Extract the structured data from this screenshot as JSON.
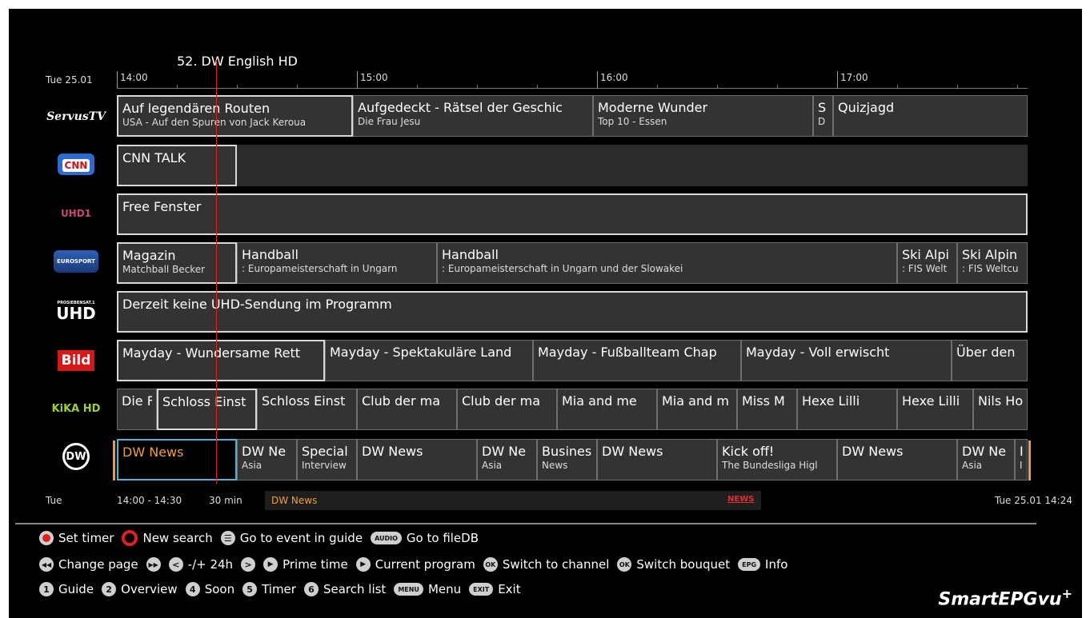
{
  "header": {
    "channel_title": "52. DW English HD",
    "date": "Tue 25.01",
    "hours": [
      "14:00",
      "15:00",
      "16:00",
      "17:00"
    ]
  },
  "channels": [
    {
      "logo": "ServusTV",
      "programs": [
        {
          "title": "Auf legendären Routen",
          "subtitle": "USA - Auf den Spuren von Jack Keroua",
          "selected": true
        },
        {
          "title": "Aufgedeckt - Rätsel der Geschic",
          "subtitle": "Die Frau Jesu"
        },
        {
          "title": "Moderne Wunder",
          "subtitle": "Top 10 - Essen"
        },
        {
          "title": "S",
          "subtitle": "D"
        },
        {
          "title": "Quizjagd",
          "subtitle": ""
        }
      ]
    },
    {
      "logo": "CNN",
      "programs": [
        {
          "title": "CNN TALK",
          "subtitle": "",
          "selected": true
        }
      ]
    },
    {
      "logo": "UHD1",
      "programs": [
        {
          "title": "Free Fenster",
          "subtitle": "",
          "selected": true
        }
      ]
    },
    {
      "logo": "EUROSPORT",
      "programs": [
        {
          "title": "Magazin",
          "subtitle": "Matchball Becker",
          "selected": true
        },
        {
          "title": "Handball",
          "subtitle": ": Europameisterschaft in Ungarn"
        },
        {
          "title": "Handball",
          "subtitle": ": Europameisterschaft in Ungarn und der Slowakei"
        },
        {
          "title": "Ski Alpi",
          "subtitle": ": FIS Welt"
        },
        {
          "title": "Ski Alpin",
          "subtitle": ": FIS Weltcu"
        }
      ]
    },
    {
      "logo": "UHD",
      "logo_small": "PROSIEBENSAT.1",
      "programs": [
        {
          "title": "Derzeit keine UHD-Sendung im Programm",
          "subtitle": "",
          "selected": true
        }
      ]
    },
    {
      "logo": "Bild",
      "programs": [
        {
          "title": "Mayday - Wundersame Rett",
          "subtitle": "",
          "selected": true
        },
        {
          "title": "Mayday - Spektakuläre Land",
          "subtitle": ""
        },
        {
          "title": "Mayday - Fußballteam Chap",
          "subtitle": ""
        },
        {
          "title": "Mayday - Voll erwischt",
          "subtitle": ""
        },
        {
          "title": "Über den",
          "subtitle": ""
        }
      ]
    },
    {
      "logo": "KiKA HD",
      "programs": [
        {
          "title": "Die F",
          "subtitle": ""
        },
        {
          "title": "Schloss Einst",
          "subtitle": "",
          "selected": true
        },
        {
          "title": "Schloss Einst",
          "subtitle": ""
        },
        {
          "title": "Club der ma",
          "subtitle": ""
        },
        {
          "title": "Club der ma",
          "subtitle": ""
        },
        {
          "title": "Mia and me",
          "subtitle": ""
        },
        {
          "title": "Mia and m",
          "subtitle": ""
        },
        {
          "title": "Miss M",
          "subtitle": ""
        },
        {
          "title": "Hexe Lilli",
          "subtitle": ""
        },
        {
          "title": "Hexe Lilli",
          "subtitle": ""
        },
        {
          "title": "Nils Ho",
          "subtitle": ""
        }
      ]
    },
    {
      "logo": "DW",
      "programs": [
        {
          "title": "DW News",
          "subtitle": "",
          "current": true
        },
        {
          "title": "DW Ne",
          "subtitle": "Asia"
        },
        {
          "title": "Special",
          "subtitle": "Interview"
        },
        {
          "title": "DW News",
          "subtitle": ""
        },
        {
          "title": "DW Ne",
          "subtitle": "Asia"
        },
        {
          "title": "Busines",
          "subtitle": "News"
        },
        {
          "title": "DW News",
          "subtitle": ""
        },
        {
          "title": "Kick off!",
          "subtitle": "The Bundesliga Higl"
        },
        {
          "title": "DW News",
          "subtitle": ""
        },
        {
          "title": "DW Ne",
          "subtitle": "Asia"
        },
        {
          "title": "I",
          "subtitle": "I"
        }
      ]
    }
  ],
  "info_bar": {
    "day": "Tue",
    "time_range": "14:00 - 14:30",
    "duration": "30 min",
    "title": "DW News",
    "genre_tag": "NEWS",
    "clock": "Tue 25.01 14:24"
  },
  "legend": {
    "row1": [
      {
        "key": "red-dot",
        "label": "Set timer"
      },
      {
        "key": "red-ring",
        "label": "New search"
      },
      {
        "key": "☰",
        "label": "Go to event in guide"
      },
      {
        "key": "AUDIO",
        "label": "Go to fileDB"
      }
    ],
    "row2": [
      {
        "key": "◀◀",
        "label": "Change page"
      },
      {
        "key": "▶▶",
        "label": ""
      },
      {
        "key": "<",
        "label": "-/+ 24h"
      },
      {
        "key": ">",
        "label": ""
      },
      {
        "key": "▶",
        "label": "Prime time"
      },
      {
        "key": "▶",
        "label": "Current program"
      },
      {
        "key": "OK",
        "label": "Switch to channel"
      },
      {
        "key": "OK",
        "label": "Switch bouquet"
      },
      {
        "key": "EPG",
        "label": "Info"
      }
    ],
    "row3": [
      {
        "key": "1",
        "label": "Guide"
      },
      {
        "key": "2",
        "label": "Overview"
      },
      {
        "key": "4",
        "label": "Soon"
      },
      {
        "key": "5",
        "label": "Timer"
      },
      {
        "key": "6",
        "label": "Search list"
      },
      {
        "key": "MENU",
        "label": "Menu"
      },
      {
        "key": "EXIT",
        "label": "Exit"
      }
    ]
  },
  "brand": {
    "name": "SmartEPGvu",
    "suffix": "+"
  },
  "colors": {
    "accent": "#f0a030",
    "current_border": "#4fb3d9",
    "now_line": "#e02020"
  }
}
